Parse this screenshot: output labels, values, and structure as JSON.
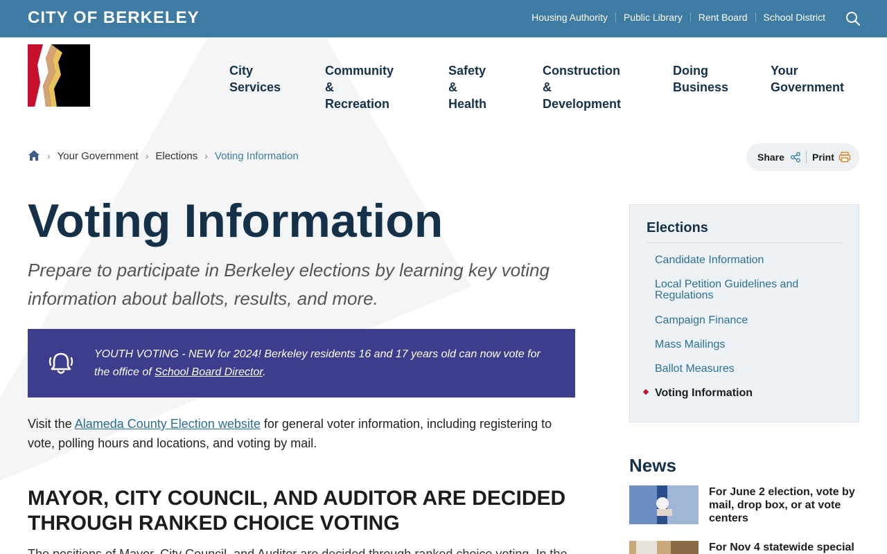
{
  "header": {
    "brand": "CITY OF BERKELEY",
    "links": [
      "Housing Authority",
      "Public Library",
      "Rent Board",
      "School District"
    ],
    "search_icon": "search-icon",
    "color": "#3e7ba3"
  },
  "nav": {
    "items": [
      "City\nServices",
      "Community &\nRecreation",
      "Safety &\nHealth",
      "Construction &\nDevelopment",
      "Doing\nBusiness",
      "Your\nGovernment"
    ]
  },
  "breadcrumb": {
    "home_icon": "home-icon",
    "items": [
      "Your Government",
      "Elections"
    ],
    "current": "Voting Information"
  },
  "actions": {
    "share": "Share",
    "print": "Print"
  },
  "page": {
    "title": "Voting Information",
    "subtitle": "Prepare to participate in Berkeley elections by learning key voting information about ballots, results, and more."
  },
  "alert": {
    "icon": "bell-icon",
    "text_before": " YOUTH VOTING - NEW for 2024! Berkeley residents 16 and 17 years old can now vote for the office of ",
    "link": "School Board Director",
    "text_after": ".",
    "bg_color": "#3d3d8d"
  },
  "intro": {
    "before": "Visit the ",
    "link": "Alameda County Election website",
    "after": " for general voter information, including registering to vote, polling hours and locations, and voting by mail."
  },
  "section": {
    "heading": "MAYOR, CITY COUNCIL, AND AUDITOR ARE DECIDED THROUGH RANKED CHOICE VOTING",
    "cut_text": "The positions of Mayor, City Council, and Auditor are decided through ranked choice voting. In the"
  },
  "sidebar": {
    "heading": "Elections",
    "items": [
      "Candidate Information",
      "Local Petition Guidelines and Regulations",
      "Campaign Finance",
      "Mass Mailings",
      "Ballot Measures"
    ],
    "active": "Voting Information"
  },
  "news": {
    "heading": "News",
    "items": [
      "For June 2 election, vote by mail, drop box, or at vote centers",
      "For Nov 4 statewide special"
    ]
  }
}
